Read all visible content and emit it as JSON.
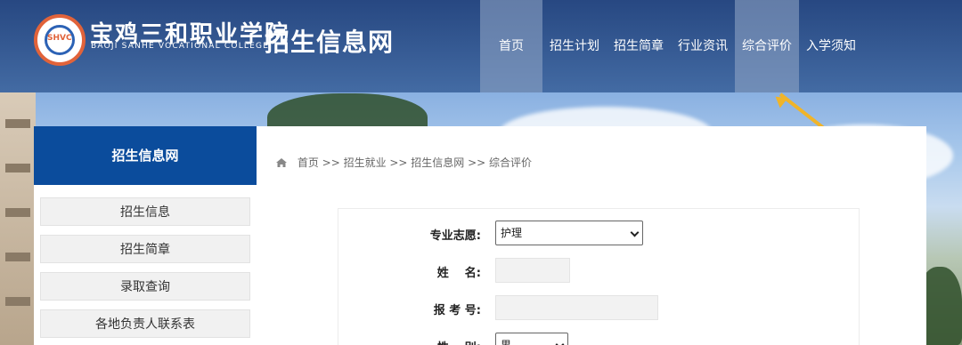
{
  "header": {
    "college_name_cn": "宝鸡三和职业学院",
    "college_name_en": "BAOJI SANHE VOCATIONAL COLLEGE",
    "site_title": "招生信息网",
    "logo_badge_text": "SHVC",
    "nav": [
      {
        "label": "首页",
        "active": true
      },
      {
        "label": "招生计划",
        "active": false
      },
      {
        "label": "招生简章",
        "active": false
      },
      {
        "label": "行业资讯",
        "active": false
      },
      {
        "label": "综合评价",
        "active": true
      },
      {
        "label": "入学须知",
        "active": false
      }
    ]
  },
  "sidebar": {
    "title": "招生信息网",
    "items": [
      {
        "label": "招生信息"
      },
      {
        "label": "招生简章"
      },
      {
        "label": "录取查询"
      },
      {
        "label": "各地负责人联系表"
      }
    ]
  },
  "breadcrumb": {
    "text": "首页 >> 招生就业 >> 招生信息网 >> 综合评价"
  },
  "form": {
    "major_label": "专业志愿:",
    "major_value": "护理",
    "name_label": "姓    名:",
    "name_value": "",
    "exam_no_label": "报 考 号:",
    "exam_no_value": "",
    "gender_label": "性    别:",
    "gender_value": "男"
  },
  "colors": {
    "header_bg": "#1e3e78",
    "sidebar_head_bg": "#0b4c9c",
    "annotation_arrow": "#f0b429",
    "logo_ring": "#e1633a"
  }
}
